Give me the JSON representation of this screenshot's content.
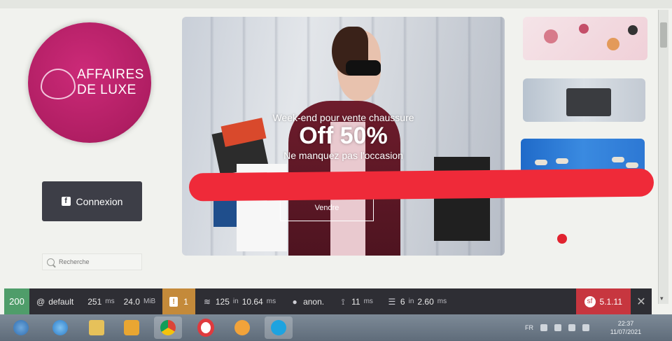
{
  "logo": {
    "line1": "AFFAIRES",
    "line2": "DE LUXE",
    "color": "#b01e63"
  },
  "sidebar": {
    "login_label": "Connexion",
    "login_icon": "facebook-icon",
    "search_placeholder": "Recherche"
  },
  "hero": {
    "line1": "Week-end pour vente chaussure",
    "line2": "Off 50%",
    "line3": "Ne manquez pas l'occasion",
    "button_label": "Vendre"
  },
  "debug_bar": {
    "status_code": "200",
    "env_prefix": "@",
    "env": "default",
    "time_value": "251",
    "time_unit": "ms",
    "memory_value": "24.0",
    "memory_unit": "MiB",
    "warnings_count": "1",
    "doctrine_queries": "125",
    "doctrine_in": "in",
    "doctrine_time": "10.64",
    "doctrine_unit": "ms",
    "user": "anon.",
    "twig_time": "11",
    "twig_unit": "ms",
    "cache_calls": "6",
    "cache_in": "in",
    "cache_time": "2.60",
    "cache_unit": "ms",
    "version": "5.1.11",
    "status_color": "#4f9d6a",
    "version_color": "#c7363f"
  },
  "taskbar": {
    "apps": [
      "start-icon",
      "internet-explorer-icon",
      "file-explorer-icon",
      "media-player-icon",
      "chrome-icon",
      "opera-icon",
      "settings-icon",
      "skype-icon"
    ],
    "language": "FR",
    "time": "22:37",
    "date": "11/07/2021"
  }
}
